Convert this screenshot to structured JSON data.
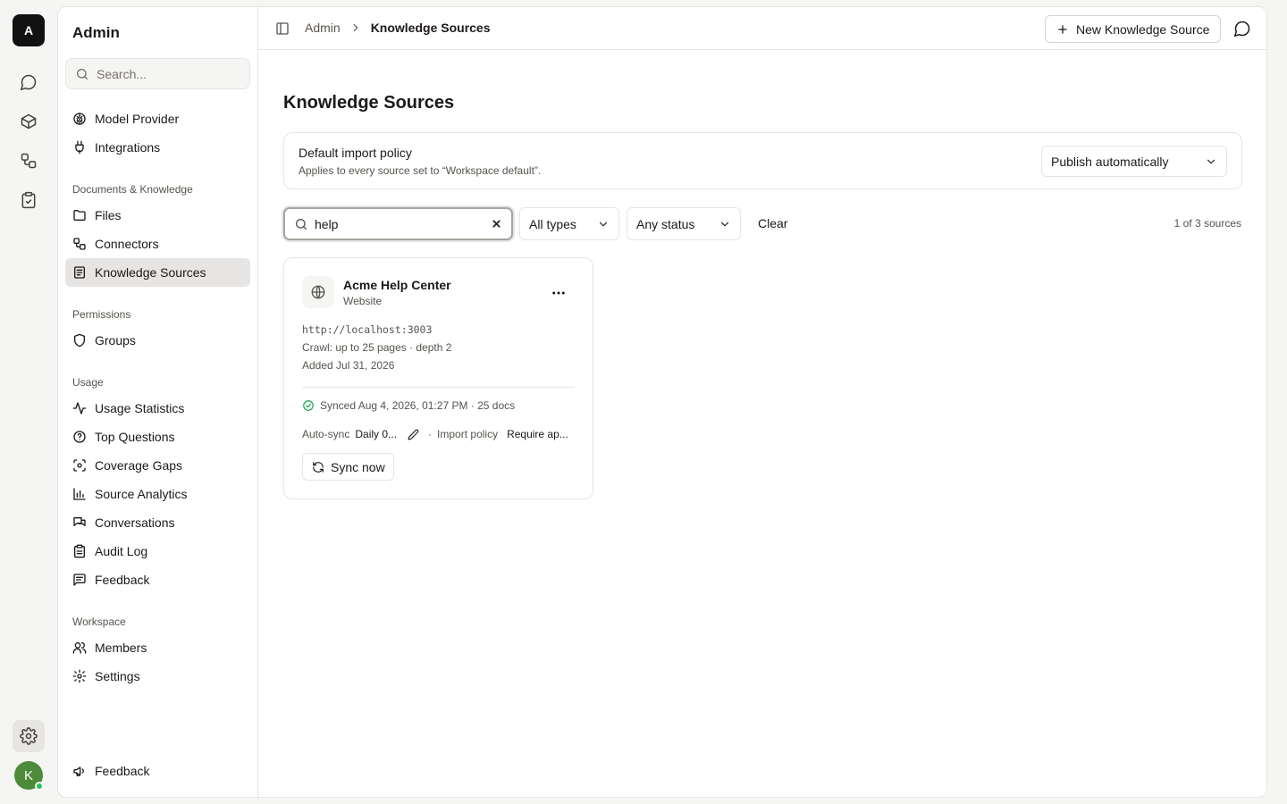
{
  "rail": {
    "logo": "A",
    "avatar_initial": "K"
  },
  "sidebar": {
    "title": "Admin",
    "search_placeholder": "Search...",
    "items_top": [
      {
        "label": "Model Provider",
        "icon": "brain-icon"
      },
      {
        "label": "Integrations",
        "icon": "plug-icon"
      }
    ],
    "groups": [
      {
        "label": "Documents & Knowledge",
        "items": [
          {
            "label": "Files",
            "icon": "folder-icon"
          },
          {
            "label": "Connectors",
            "icon": "workflow-icon"
          },
          {
            "label": "Knowledge Sources",
            "icon": "book-icon",
            "active": true
          }
        ]
      },
      {
        "label": "Permissions",
        "items": [
          {
            "label": "Groups",
            "icon": "shield-icon"
          }
        ]
      },
      {
        "label": "Usage",
        "items": [
          {
            "label": "Usage Statistics",
            "icon": "activity-icon"
          },
          {
            "label": "Top Questions",
            "icon": "help-circle-icon"
          },
          {
            "label": "Coverage Gaps",
            "icon": "scan-icon"
          },
          {
            "label": "Source Analytics",
            "icon": "bar-chart-icon"
          },
          {
            "label": "Conversations",
            "icon": "messages-icon"
          },
          {
            "label": "Audit Log",
            "icon": "clipboard-icon"
          },
          {
            "label": "Feedback",
            "icon": "message-square-text-icon"
          }
        ]
      },
      {
        "label": "Workspace",
        "items": [
          {
            "label": "Members",
            "icon": "users-icon"
          },
          {
            "label": "Settings",
            "icon": "gear-icon"
          }
        ]
      }
    ],
    "footer_feedback": "Feedback"
  },
  "topbar": {
    "breadcrumb_root": "Admin",
    "breadcrumb_current": "Knowledge Sources",
    "new_button": "New Knowledge Source"
  },
  "page": {
    "title": "Knowledge Sources",
    "policy": {
      "title": "Default import policy",
      "subtitle": "Applies to every source set to “Workspace default”.",
      "selected": "Publish automatically"
    },
    "filters": {
      "search_value": "help",
      "type_selected": "All types",
      "status_selected": "Any status",
      "clear_label": "Clear",
      "count": "1 of 3 sources"
    },
    "sources": [
      {
        "name": "Acme Help Center",
        "type": "Website",
        "url": "http://localhost:3003",
        "crawl": "Crawl: up to 25 pages · depth 2",
        "added": "Added Jul 31, 2026",
        "sync_status": "Synced Aug 4, 2026, 01:27 PM · 25 docs",
        "auto_sync_label": "Auto-sync",
        "auto_sync_value": "Daily 0...",
        "import_policy_label": "Import policy",
        "import_policy_value": "Require ap...",
        "sync_button": "Sync now"
      }
    ]
  }
}
